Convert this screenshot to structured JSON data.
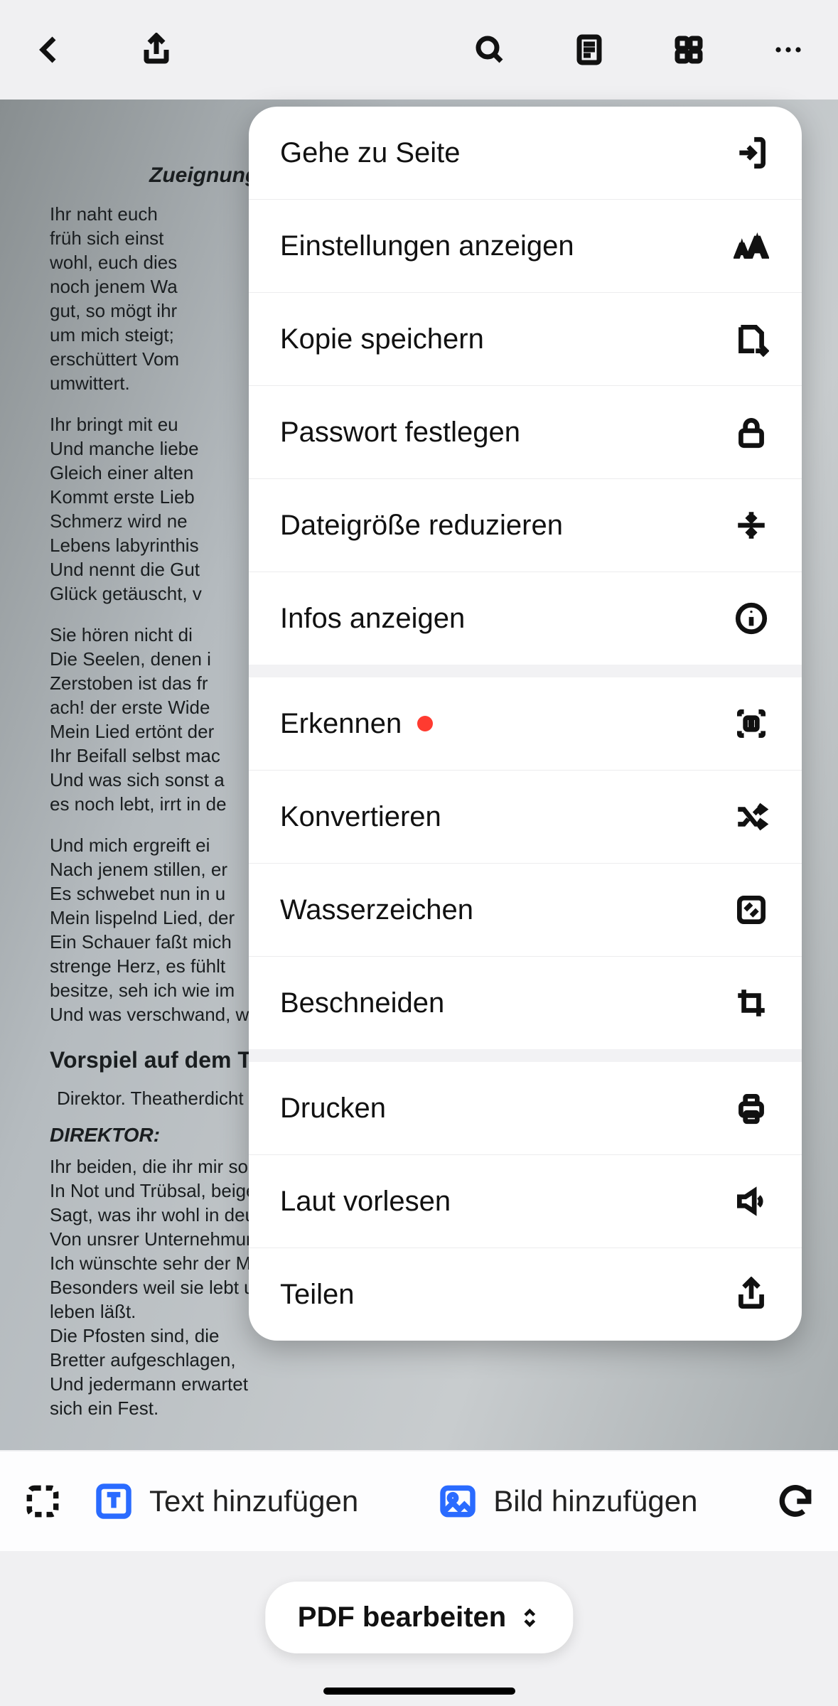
{
  "topbar": {
    "back": "Zurück",
    "share": "Teilen",
    "search": "Suchen",
    "thumbnails": "Miniaturen",
    "grid": "Raster",
    "more": "Mehr"
  },
  "document": {
    "title": "Zueignung.",
    "stanza1": "Ihr naht euch\nfrüh sich einst\nwohl, euch dies\nnoch jenem Wa\ngut, so mögt ihr\num mich steigt;\nerschüttert Vom\numwittert.",
    "stanza2": "Ihr bringt mit eu\nUnd manche liebe\nGleich einer alten\nKommt erste Lieb\nSchmerz wird ne\nLebens labyrinthis\nUnd nennt die Gut\nGlück getäuscht, v",
    "stanza3": "Sie hören nicht di\nDie Seelen, denen i\nZerstoben ist das fr\nach! der erste Wide\nMein Lied ertönt der\nIhr Beifall selbst mac\nUnd was sich sonst a\nes noch lebt, irrt in de",
    "stanza4": "Und mich ergreift ei\nNach jenem stillen, er\nEs schwebet nun in u\nMein lispelnd Lied, der\nEin Schauer faßt mich\nstrenge Herz, es fühlt\nbesitze, seh ich wie im\nUnd was verschwand, w",
    "vorspiel": "Vorspiel auf dem Th",
    "roles": "Direktor. Theatherdicht",
    "direktor_label": "DIREKTOR:",
    "direktor": "Ihr beiden, die ihr mir so o\nIn Not und Trübsal, beiges\nSagt, was ihr wohl in deuts\nVon unsrer Unternehmung\nIch wünschte sehr der Men\nBesonders weil sie lebt und leben läßt.\nDie Pfosten sind, die Bretter aufgeschlagen,\nUnd jedermann erwartet sich ein Fest."
  },
  "menu": {
    "g1": {
      "goto": "Gehe zu Seite",
      "settings": "Einstellungen anzeigen",
      "savecopy": "Kopie speichern",
      "password": "Passwort festlegen",
      "reduce": "Dateigröße reduzieren",
      "info": "Infos anzeigen"
    },
    "g2": {
      "recognize": "Erkennen",
      "convert": "Konvertieren",
      "watermark": "Wasserzeichen",
      "crop": "Beschneiden"
    },
    "g3": {
      "print": "Drucken",
      "readaloud": "Laut vorlesen",
      "share": "Teilen"
    }
  },
  "editbar": {
    "select": "Auswahl",
    "addtext": "Text hinzufügen",
    "addimage": "Bild hinzufügen",
    "undo": "Rückgängig"
  },
  "mode": {
    "label": "PDF bearbeiten"
  }
}
